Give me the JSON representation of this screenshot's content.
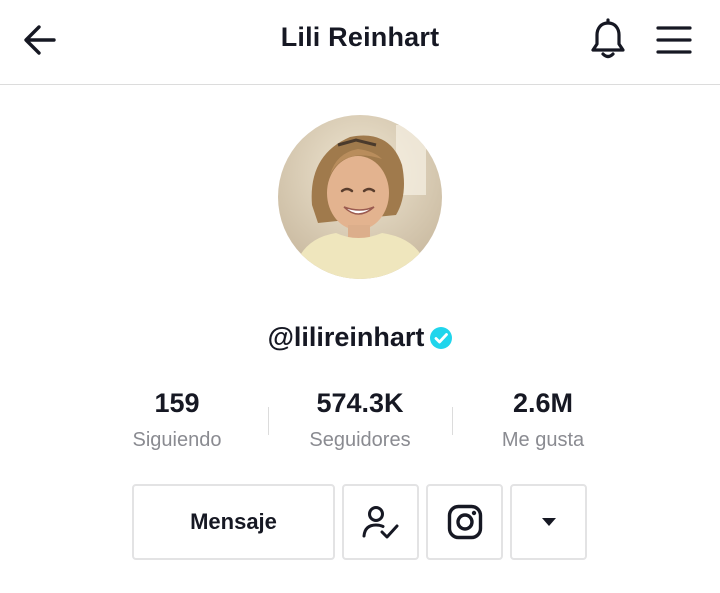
{
  "header": {
    "title": "Lili Reinhart",
    "back_icon": "arrow-left-icon",
    "bell_icon": "bell-icon",
    "menu_icon": "hamburger-menu-icon"
  },
  "profile": {
    "handle": "@lilireinhart",
    "verified_icon": "verified-badge-icon",
    "verified_color": "#20d5ec"
  },
  "stats": [
    {
      "value": "159",
      "label": "Siguiendo"
    },
    {
      "value": "574.3K",
      "label": "Seguidores"
    },
    {
      "value": "2.6M",
      "label": "Me gusta"
    }
  ],
  "actions": {
    "message_label": "Mensaje",
    "following_icon": "person-check-icon",
    "instagram_icon": "instagram-icon",
    "more_icon": "caret-down-icon"
  }
}
